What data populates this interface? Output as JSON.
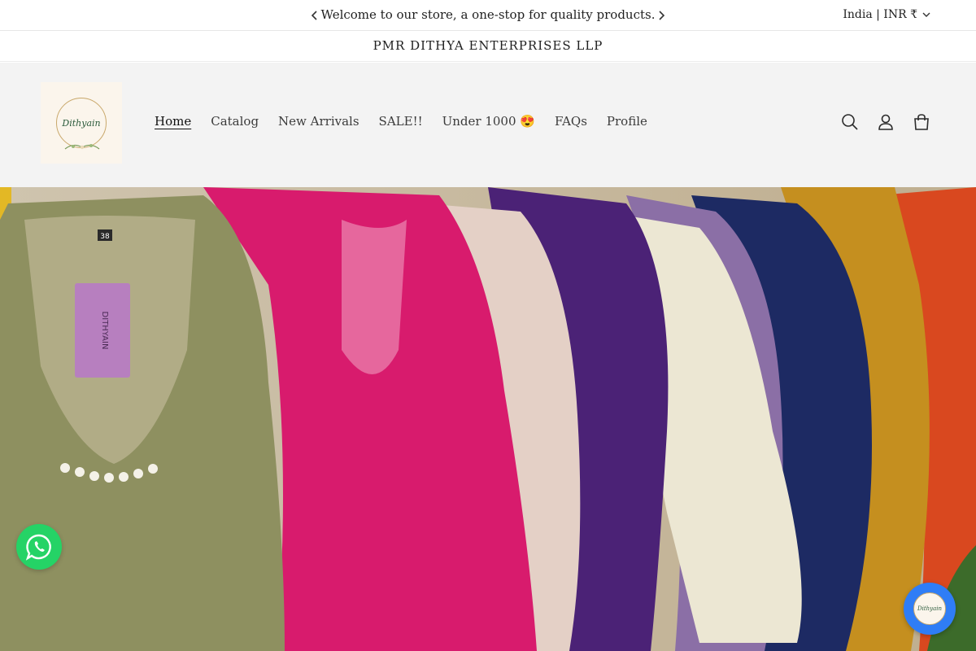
{
  "announcement": {
    "message": "Welcome to our store, a one-stop for quality products.",
    "prev_icon": "chevron-left-icon",
    "next_icon": "chevron-right-icon",
    "locale": "India | INR ₹"
  },
  "company": {
    "name": "PMR DITHYA ENTERPRISES LLP"
  },
  "header": {
    "logo_text": "Dithyain",
    "nav": [
      {
        "label": "Home"
      },
      {
        "label": "Catalog"
      },
      {
        "label": "New Arrivals"
      },
      {
        "label": "SALE!!"
      },
      {
        "label": "Under 1000 😍"
      },
      {
        "label": "FAQs"
      },
      {
        "label": "Profile"
      }
    ],
    "icons": [
      "search-icon",
      "account-icon",
      "cart-icon"
    ]
  },
  "hero": {
    "tag_text": "DITHYAIN",
    "size_label": "38"
  },
  "floating": {
    "whatsapp_icon": "whatsapp-icon",
    "chatbot_text": "Dithyain"
  },
  "colors": {
    "whatsapp": "#25d366",
    "chatbot": "#2f7df6",
    "header_bg": "#f3f3f3"
  }
}
